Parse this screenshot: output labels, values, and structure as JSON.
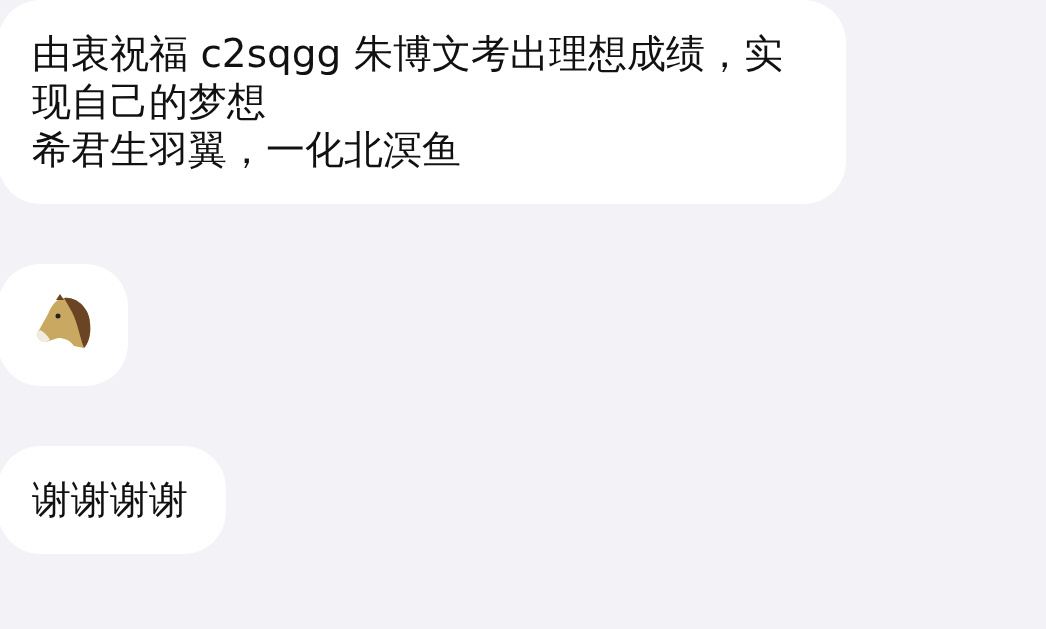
{
  "messages": [
    {
      "kind": "lines",
      "lines": [
        "由衷祝福 c2sqgg 朱博文考出理想成绩，实现自己的梦想",
        "希君生羽翼，一化北溟鱼"
      ]
    },
    {
      "kind": "emoji"
    },
    {
      "kind": "text",
      "text": "谢谢谢谢"
    }
  ]
}
